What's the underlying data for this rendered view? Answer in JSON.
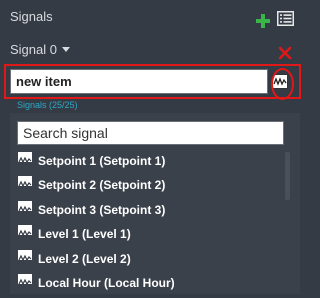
{
  "panel": {
    "title": "Signals"
  },
  "signal": {
    "name": "Signal 0"
  },
  "item": {
    "value": "new item"
  },
  "signals_count": "Signals (25/25)",
  "search": {
    "placeholder": "Search signal"
  },
  "list": {
    "items": [
      {
        "label": "Setpoint 1 (Setpoint 1)"
      },
      {
        "label": "Setpoint 2 (Setpoint 2)"
      },
      {
        "label": "Setpoint 3 (Setpoint 3)"
      },
      {
        "label": "Level 1 (Level 1)"
      },
      {
        "label": "Level 2 (Level 2)"
      },
      {
        "label": "Local Hour (Local Hour)"
      }
    ]
  },
  "icons": {
    "add": "plus-icon",
    "list": "list-icon",
    "remove": "close-icon",
    "signal": "waveform-icon"
  },
  "colors": {
    "background": "#353b44",
    "accent_green": "#39b54a",
    "highlight_red": "#e01818",
    "count_blue": "#2da8c8"
  }
}
